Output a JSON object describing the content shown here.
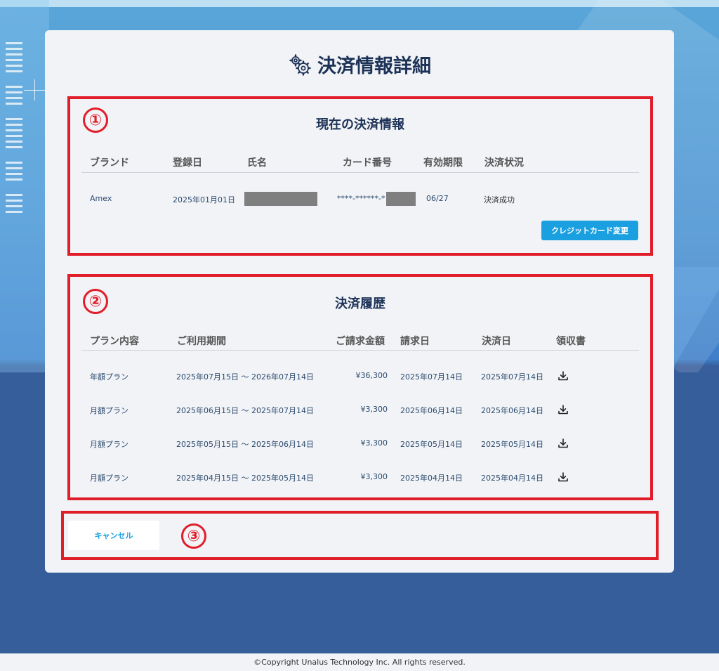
{
  "page": {
    "title": "決済情報詳細"
  },
  "current": {
    "number": "①",
    "title": "現在の決済情報",
    "headers": [
      "ブランド",
      "登録日",
      "氏名",
      "カード番号",
      "有効期限",
      "決済状況"
    ],
    "row": {
      "brand": "Amex",
      "registered": "2025年01月01日",
      "card_prefix": "****-******-*",
      "expiry": "06/27",
      "status": "決済成功"
    },
    "change_button": "クレジットカード変更"
  },
  "history": {
    "number": "②",
    "title": "決済履歴",
    "headers": [
      "プラン内容",
      "ご利用期間",
      "ご請求金額",
      "請求日",
      "決済日",
      "領収書"
    ],
    "rows": [
      {
        "plan": "年額プラン",
        "period": "2025年07月15日 〜 2026年07月14日",
        "amount": "¥36,300",
        "billed": "2025年07月14日",
        "paid": "2025年07月14日"
      },
      {
        "plan": "月額プラン",
        "period": "2025年06月15日 〜 2025年07月14日",
        "amount": "¥3,300",
        "billed": "2025年06月14日",
        "paid": "2025年06月14日"
      },
      {
        "plan": "月額プラン",
        "period": "2025年05月15日 〜 2025年06月14日",
        "amount": "¥3,300",
        "billed": "2025年05月14日",
        "paid": "2025年05月14日"
      },
      {
        "plan": "月額プラン",
        "period": "2025年04月15日 〜 2025年05月14日",
        "amount": "¥3,300",
        "billed": "2025年04月14日",
        "paid": "2025年04月14日"
      }
    ]
  },
  "actions": {
    "number": "③",
    "cancel_button": "キャンセル"
  },
  "footer": {
    "copyright": "©Copyright Unalus Technology Inc. All rights reserved."
  },
  "icons": {
    "title_icon": "gears-icon",
    "download_icon": "download-icon"
  },
  "colors": {
    "highlight": "#e11d2a",
    "accent": "#1aa0e0",
    "heading": "#1d3257"
  }
}
